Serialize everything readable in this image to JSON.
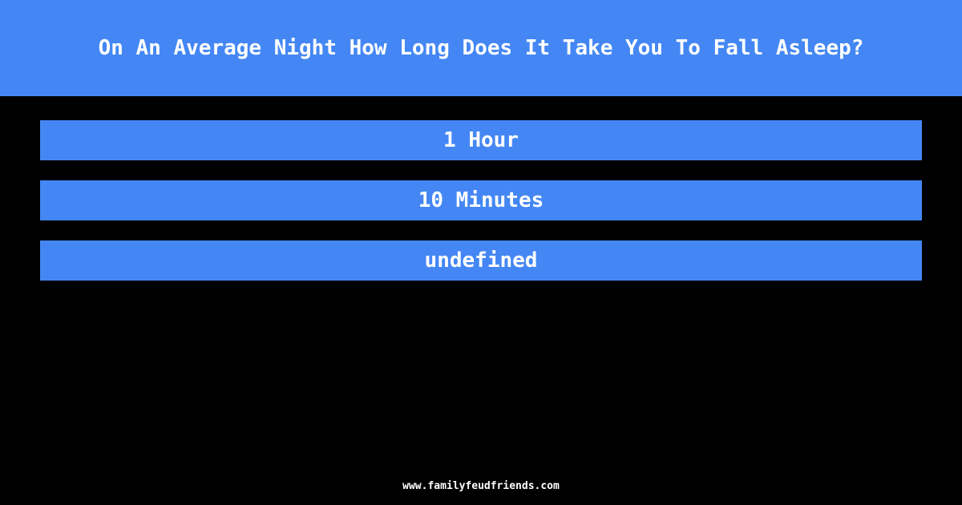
{
  "question": "On An Average Night How Long Does It Take You To Fall Asleep?",
  "answers": [
    "1 Hour",
    "10 Minutes",
    "undefined"
  ],
  "footer": "www.familyfeudfriends.com",
  "colors": {
    "accent": "#4487f4",
    "background": "#000000",
    "text": "#ffffff"
  }
}
